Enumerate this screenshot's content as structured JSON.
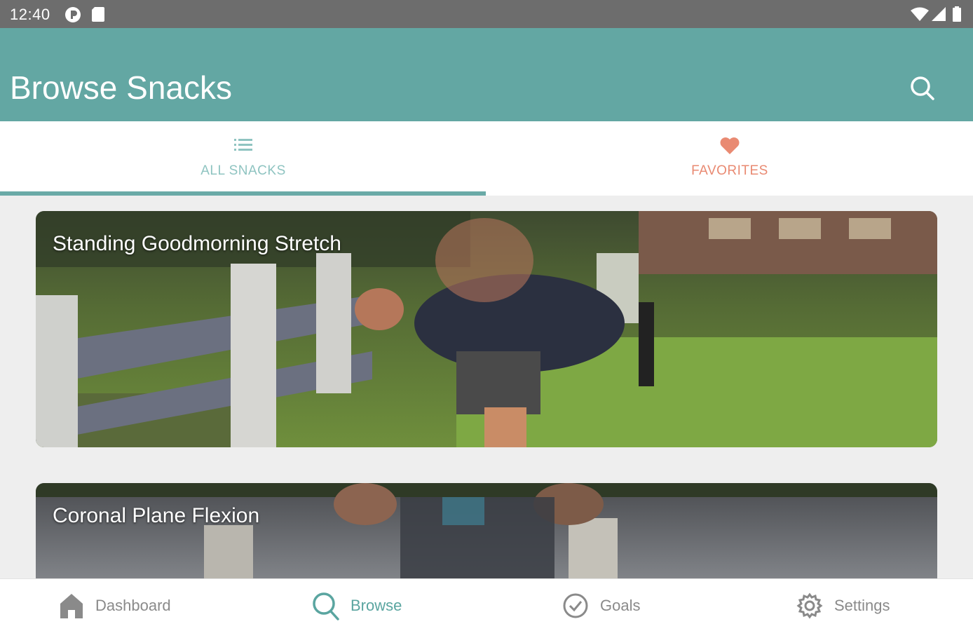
{
  "status_bar": {
    "time": "12:40",
    "icons_left": [
      "media-icon",
      "sd-card-icon"
    ],
    "icons_right": [
      "wifi-icon",
      "cell-signal-icon",
      "battery-icon"
    ]
  },
  "app_bar": {
    "title": "Browse Snacks",
    "action_icon": "search-icon",
    "color": "#63a7a3"
  },
  "tabs": [
    {
      "label": "ALL SNACKS",
      "icon": "list-icon",
      "selected": true,
      "color": "#8fc4c1"
    },
    {
      "label": "FAVORITES",
      "icon": "heart-icon",
      "selected": false,
      "color": "#e98a72"
    }
  ],
  "snacks": [
    {
      "title": "Standing Goodmorning Stretch",
      "image": "park-fence-stretch"
    },
    {
      "title": "Coronal Plane Flexion",
      "image": "lake-side-bend"
    }
  ],
  "bottom_nav": [
    {
      "label": "Dashboard",
      "icon": "home-icon",
      "active": false
    },
    {
      "label": "Browse",
      "icon": "search-icon",
      "active": true
    },
    {
      "label": "Goals",
      "icon": "check-circle-icon",
      "active": false
    },
    {
      "label": "Settings",
      "icon": "gear-icon",
      "active": false
    }
  ],
  "colors": {
    "accent": "#63a7a3",
    "favorite": "#e98a72",
    "inactive": "#8a8a8a"
  }
}
